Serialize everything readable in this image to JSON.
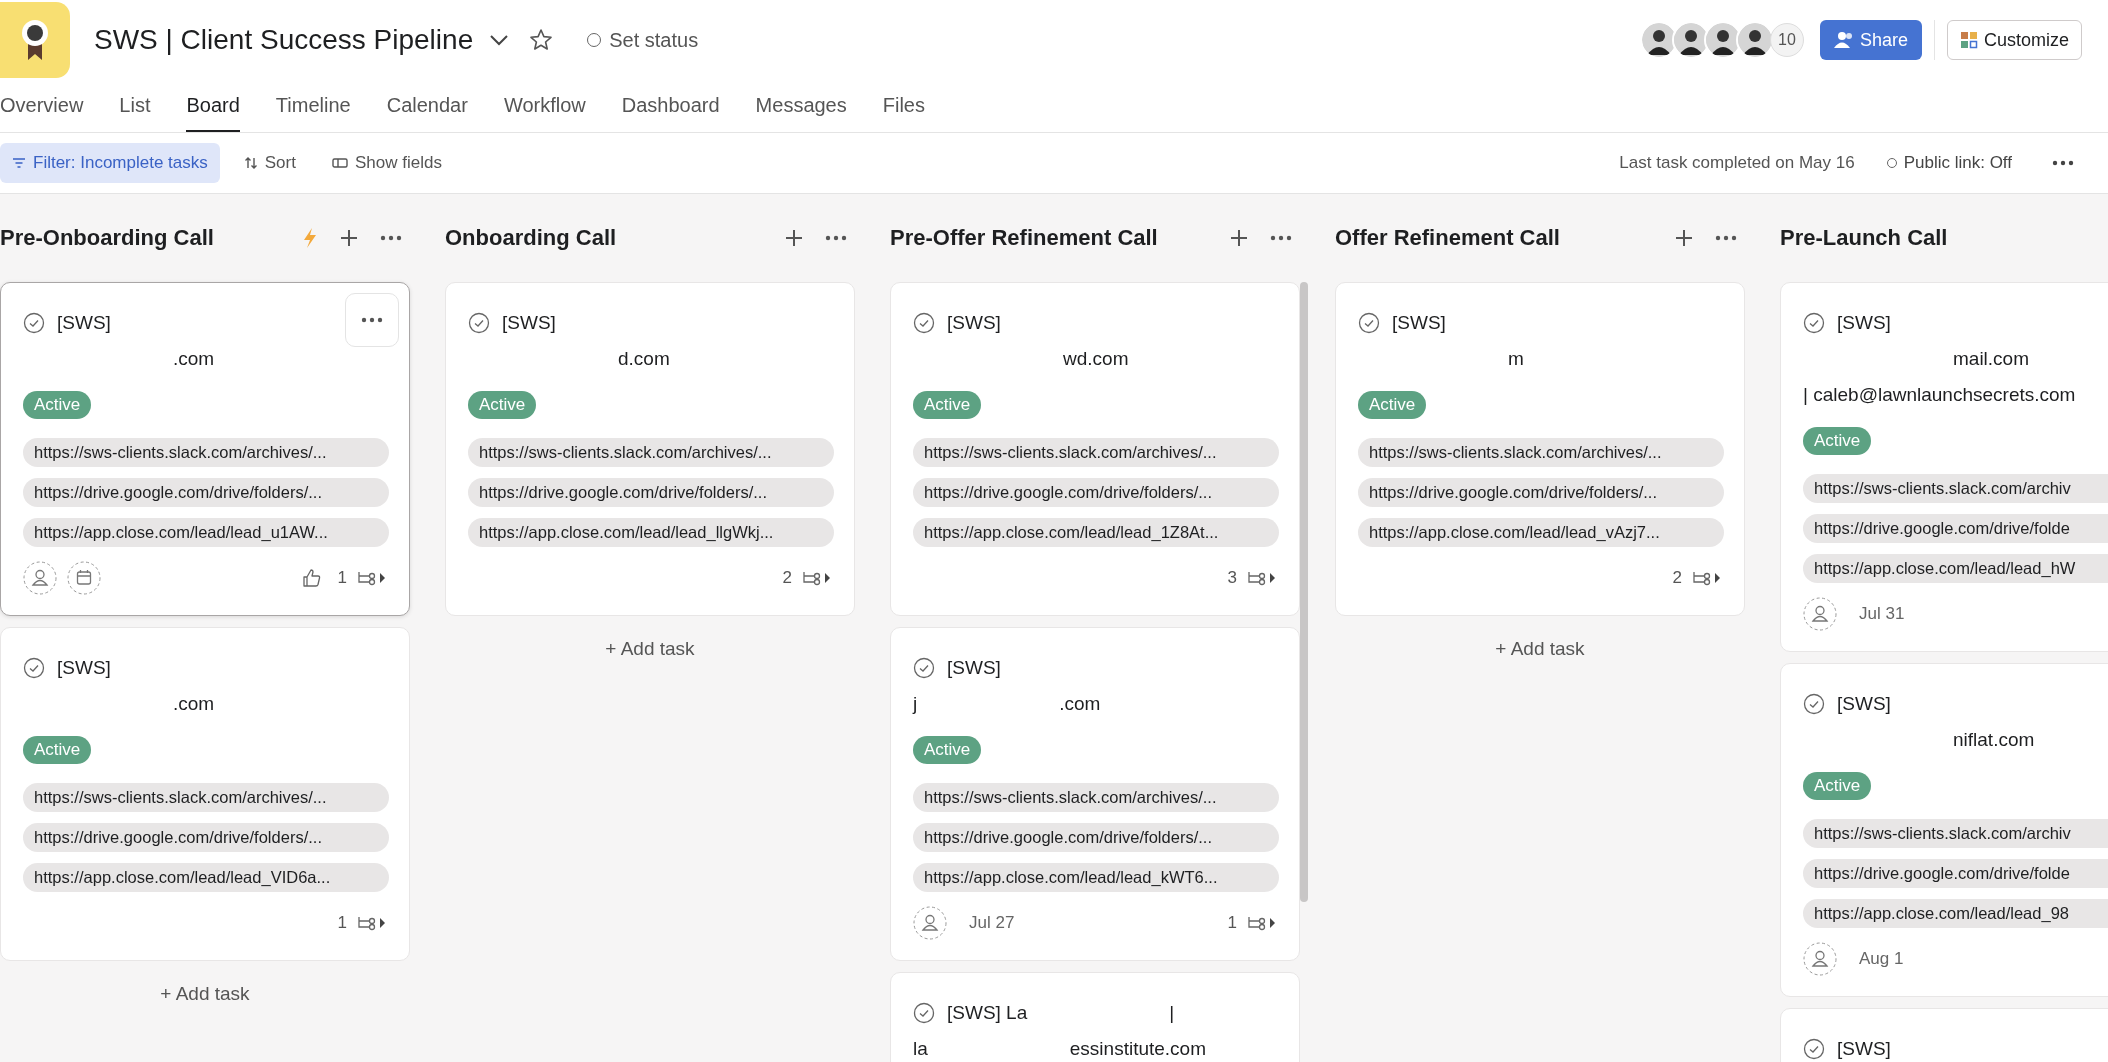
{
  "project": {
    "title": "SWS | Client Success Pipeline",
    "set_status": "Set status"
  },
  "members": {
    "count": "10"
  },
  "share_button": "Share",
  "customize_button": "Customize",
  "tabs": [
    {
      "label": "Overview",
      "selected": false
    },
    {
      "label": "List",
      "selected": false
    },
    {
      "label": "Board",
      "selected": true
    },
    {
      "label": "Timeline",
      "selected": false
    },
    {
      "label": "Calendar",
      "selected": false
    },
    {
      "label": "Workflow",
      "selected": false
    },
    {
      "label": "Dashboard",
      "selected": false
    },
    {
      "label": "Messages",
      "selected": false
    },
    {
      "label": "Files",
      "selected": false
    }
  ],
  "toolbar": {
    "filter": {
      "label": "Filter: Incomplete tasks",
      "active": true
    },
    "sort": "Sort",
    "show_fields": "Show fields",
    "last_completed": "Last task completed on May 16",
    "public_link": "Public link: Off"
  },
  "columns": [
    {
      "title": "Pre-Onboarding Call",
      "rule": true,
      "controls": true,
      "scrollbar": false,
      "add_task": "+ Add task",
      "cards": [
        {
          "hovered": true,
          "lines": [
            {
              "parts": [
                "[SWS]"
              ]
            },
            {
              "parts": [
                ".com"
              ]
            }
          ],
          "tag": "Active",
          "links": [
            "https://sws-clients.slack.com/archives/...",
            "https://drive.google.com/drive/folders/...",
            "https://app.close.com/lead/lead_u1AW..."
          ],
          "footer": [
            {
              "kind": "assignee"
            },
            {
              "kind": "due-date"
            }
          ],
          "like": true,
          "subtasks": "1"
        },
        {
          "hovered": false,
          "lines": [
            {
              "parts": [
                "[SWS]"
              ]
            },
            {
              "parts": [
                ".com"
              ]
            }
          ],
          "tag": "Active",
          "links": [
            "https://sws-clients.slack.com/archives/...",
            "https://drive.google.com/drive/folders/...",
            "https://app.close.com/lead/lead_VID6a..."
          ],
          "like": false,
          "subtasks": "1"
        }
      ]
    },
    {
      "title": "Onboarding Call",
      "rule": false,
      "controls": true,
      "scrollbar": false,
      "add_task": "+ Add task",
      "cards": [
        {
          "hovered": false,
          "lines": [
            {
              "parts": [
                "[SWS]"
              ]
            },
            {
              "parts": [
                "d.com"
              ]
            }
          ],
          "tag": "Active",
          "links": [
            "https://sws-clients.slack.com/archives/...",
            "https://drive.google.com/drive/folders/...",
            "https://app.close.com/lead/lead_llgWkj..."
          ],
          "like": false,
          "subtasks": "2"
        }
      ]
    },
    {
      "title": "Pre-Offer Refinement Call",
      "rule": false,
      "controls": true,
      "scrollbar": true,
      "cards": [
        {
          "hovered": false,
          "lines": [
            {
              "parts": [
                "[SWS]"
              ]
            },
            {
              "parts": [
                "wd.com"
              ]
            }
          ],
          "tag": "Active",
          "links": [
            "https://sws-clients.slack.com/archives/...",
            "https://drive.google.com/drive/folders/...",
            "https://app.close.com/lead/lead_1Z8At..."
          ],
          "like": false,
          "subtasks": "3"
        },
        {
          "hovered": false,
          "lines": [
            {
              "parts": [
                "[SWS]"
              ]
            },
            {
              "parts": [
                "j",
                ".com"
              ]
            }
          ],
          "tag": "Active",
          "links": [
            "https://sws-clients.slack.com/archives/...",
            "https://drive.google.com/drive/folders/...",
            "https://app.close.com/lead/lead_kWT6..."
          ],
          "footer": [
            {
              "kind": "assignee"
            },
            {
              "kind": "date",
              "text": "Jul 27"
            }
          ],
          "like": false,
          "subtasks": "1"
        },
        {
          "hovered": false,
          "lines": [
            {
              "parts": [
                "[SWS] La",
                "|"
              ]
            },
            {
              "parts": [
                "la",
                "essinstitute.com"
              ]
            }
          ],
          "like": false
        }
      ]
    },
    {
      "title": "Offer Refinement Call",
      "rule": false,
      "controls": true,
      "scrollbar": false,
      "add_task": "+ Add task",
      "cards": [
        {
          "hovered": false,
          "lines": [
            {
              "parts": [
                "[SWS]"
              ]
            },
            {
              "parts": [
                "m"
              ]
            }
          ],
          "tag": "Active",
          "links": [
            "https://sws-clients.slack.com/archives/...",
            "https://drive.google.com/drive/folders/...",
            "https://app.close.com/lead/lead_vAzj7..."
          ],
          "like": false,
          "subtasks": "2"
        }
      ]
    },
    {
      "title": "Pre-Launch Call",
      "rule": false,
      "controls": false,
      "scrollbar": false,
      "cards": [
        {
          "hovered": false,
          "lines": [
            {
              "parts": [
                "[SWS]"
              ]
            },
            {
              "parts": [
                "mail.com"
              ]
            },
            {
              "parts": [
                "| caleb@lawnlaunchsecrets.com"
              ]
            }
          ],
          "tag": "Active",
          "links": [
            "https://sws-clients.slack.com/archiv",
            "https://drive.google.com/drive/folde",
            "https://app.close.com/lead/lead_hW"
          ],
          "footer": [
            {
              "kind": "assignee"
            },
            {
              "kind": "date",
              "text": "Jul 31"
            }
          ],
          "like": false
        },
        {
          "hovered": false,
          "lines": [
            {
              "parts": [
                "[SWS]"
              ]
            },
            {
              "parts": [
                "niflat.com"
              ]
            }
          ],
          "tag": "Active",
          "links": [
            "https://sws-clients.slack.com/archiv",
            "https://drive.google.com/drive/folde",
            "https://app.close.com/lead/lead_98"
          ],
          "footer": [
            {
              "kind": "assignee"
            },
            {
              "kind": "date",
              "text": "Aug 1"
            }
          ],
          "like": false
        },
        {
          "hovered": false,
          "lines": [
            {
              "parts": [
                "[SWS]"
              ]
            }
          ],
          "like": false
        }
      ]
    }
  ]
}
